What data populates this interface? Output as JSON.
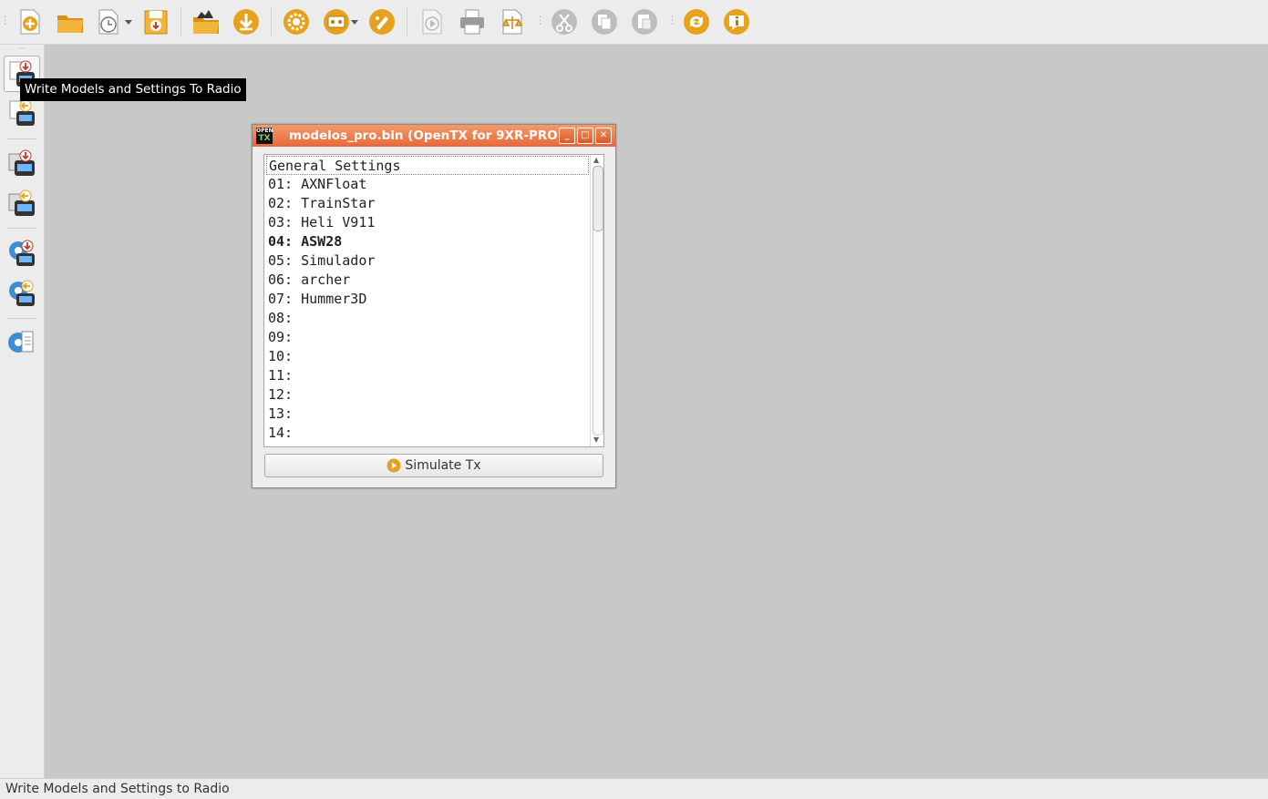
{
  "toolbar": {
    "buttons": [
      {
        "icon": "new-icon"
      },
      {
        "icon": "open-icon"
      },
      {
        "icon": "recent-files-icon"
      },
      {
        "icon": "save-icon"
      },
      {
        "icon": "open-sd-icon"
      },
      {
        "icon": "download-icon"
      },
      {
        "icon": "preferences-icon"
      },
      {
        "icon": "profile-icon"
      },
      {
        "icon": "customize-icon"
      },
      {
        "icon": "simulate-icon"
      },
      {
        "icon": "print-icon"
      },
      {
        "icon": "compare-icon"
      },
      {
        "icon": "cut-icon"
      },
      {
        "icon": "copy-icon"
      },
      {
        "icon": "paste-icon"
      },
      {
        "icon": "check-updates-icon"
      },
      {
        "icon": "about-icon"
      }
    ]
  },
  "sidebar": {
    "buttons": [
      {
        "icon": "write-models-to-radio-icon"
      },
      {
        "icon": "read-models-from-radio-icon"
      },
      {
        "icon": "write-firmware-icon"
      },
      {
        "icon": "read-firmware-icon"
      },
      {
        "icon": "write-eeprom-icon"
      },
      {
        "icon": "read-eeprom-icon"
      },
      {
        "icon": "burn-config-icon"
      }
    ]
  },
  "tooltip": {
    "text": "Write Models and Settings To Radio"
  },
  "window": {
    "title": "modelos_pro.bin (OpenTX for 9XR-PRO)",
    "logo_top": "OPEN",
    "logo_bottom": "TX",
    "list": [
      "General Settings",
      "01: AXNFloat",
      "02: TrainStar",
      "03: Heli V911",
      "04: ASW28",
      "05: Simulador",
      "06: archer",
      "07: Hummer3D",
      "08:",
      "09:",
      "10:",
      "11:",
      "12:",
      "13:",
      "14:"
    ],
    "simulate_label": "Simulate Tx"
  },
  "status": {
    "text": "Write Models and Settings to Radio"
  },
  "colors": {
    "accent": "#e8683a",
    "icon_gold": "#e6a21f",
    "background": "#c8c8c8"
  }
}
